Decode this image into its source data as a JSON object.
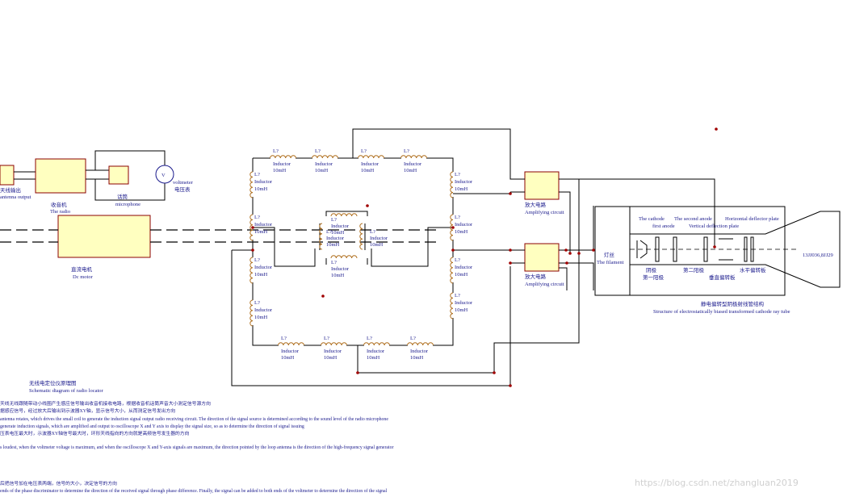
{
  "colors": {
    "wire": "#000000",
    "box_fill": "#ffffc0",
    "box_stroke": "#8b0000",
    "coil": "#b07020",
    "text": "#1a1a8c",
    "junction": "#a00000",
    "bg": "#ffffff"
  },
  "labels": {
    "antenna_output_cn": "天线输出",
    "antenna_output_en": "antenna output",
    "radio_cn": "收音机",
    "radio_en": "The radio",
    "earphone_cn": "话筒",
    "earphone_en": "microphone",
    "voltmeter_symbol": "V",
    "voltmeter_en": "voltmeter",
    "voltmeter_cn": "电压表",
    "dc_motor_cn": "直流电机",
    "dc_motor_en": "Dc motor",
    "amp_top_cn": "放大电路",
    "amp_top_en": "Amplifying circuit",
    "amp_bottom_cn": "放大电路",
    "amp_bottom_en": "Amplifying circuit",
    "filament_cn": "灯丝",
    "filament_en": "The filament",
    "cathode_en": "The cathode",
    "second_anode_en": "The second anode",
    "h_plate_en": "Horizontal deflector plate",
    "first_anode_en": "first anode",
    "v_plate_en": "Vertical deflection plate",
    "grid_cn": "阴极",
    "first_anode_cn": "第一阳极",
    "second_anode_cn": "第二阳极",
    "v_plate_cn": "垂直偏转板",
    "h_plate_cn": "水平偏转板",
    "tube_model": "13JJ036,8JJ29",
    "tube_title_cn": "静电偏转型阴极射线管结构",
    "tube_title_en": "Structure of electrostatically biased transformed cathode ray tube",
    "diagram_title_cn": "无线电定位仪原理图",
    "diagram_title_en": "Schematic diagram of radio locator",
    "inductor_ref": "L?",
    "inductor_name": "Inductor",
    "inductor_value": "10mH"
  },
  "notes": [
    "天线无线跟随带动小线圈产生感应信号输出收音机接收电路，根据收音机话筒声音大小测定信号源方向",
    "据感应信号，经过放大后输出到示波器XY轴，显示信号大小，从而测定信号发出方向",
    "antenna rotates, which drives the small coil to generate the induction signal output radio receiving circuit. The direction of the signal source is determined according to the sound level of the radio microphone",
    "generate induction signals, which are amplified and output to oscilloscope X and Y axis to display the signal size, so as to determine the direction of signal issuing",
    "压表电压最大时，示波器XY轴信号最大时，环形天线指向的方向就是高频信号发生器的方向",
    "s loudest, when the voltmeter voltage is maximum, and when the oscilloscope X and Y-axis signals are maximum, the direction pointed by the loop antenna is the direction of the high-frequency signal generator",
    "后把信号加在电压表两端，信号的大小，决定信号的方向",
    "ends of the phase discriminator to determine the direction of the received signal through phase difference. Finally, the signal can be added to both ends of the voltmeter to determine the direction of the signal"
  ],
  "watermark": "https://blog.csdn.net/zhangluan2019"
}
